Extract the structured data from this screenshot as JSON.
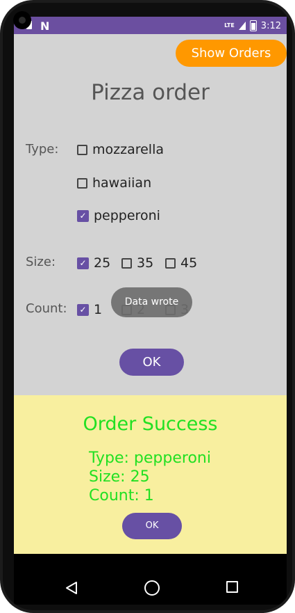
{
  "status_bar": {
    "time": "3:12",
    "network": "LTE"
  },
  "app": {
    "show_orders_label": "Show Orders",
    "title": "Pizza order",
    "type_label": "Type:",
    "types": [
      {
        "label": "mozzarella",
        "checked": false
      },
      {
        "label": "hawaiian",
        "checked": false
      },
      {
        "label": "pepperoni",
        "checked": true
      }
    ],
    "size_label": "Size:",
    "sizes": [
      {
        "label": "25",
        "checked": true
      },
      {
        "label": "35",
        "checked": false
      },
      {
        "label": "45",
        "checked": false
      }
    ],
    "count_label": "Count:",
    "counts": [
      {
        "label": "1",
        "checked": true
      },
      {
        "label": "2",
        "checked": false
      },
      {
        "label": "3",
        "checked": false
      }
    ],
    "ok_label": "OK",
    "toast": "Data wrote"
  },
  "result": {
    "title": "Order Success",
    "type_line": "Type: pepperoni",
    "size_line": "Size: 25",
    "count_line": "Count: 1",
    "ok_label": "OK"
  },
  "colors": {
    "accent": "#6750a4",
    "orange": "#ff9800",
    "success_text": "#22e022",
    "panel_bg": "#f8ef9f"
  }
}
